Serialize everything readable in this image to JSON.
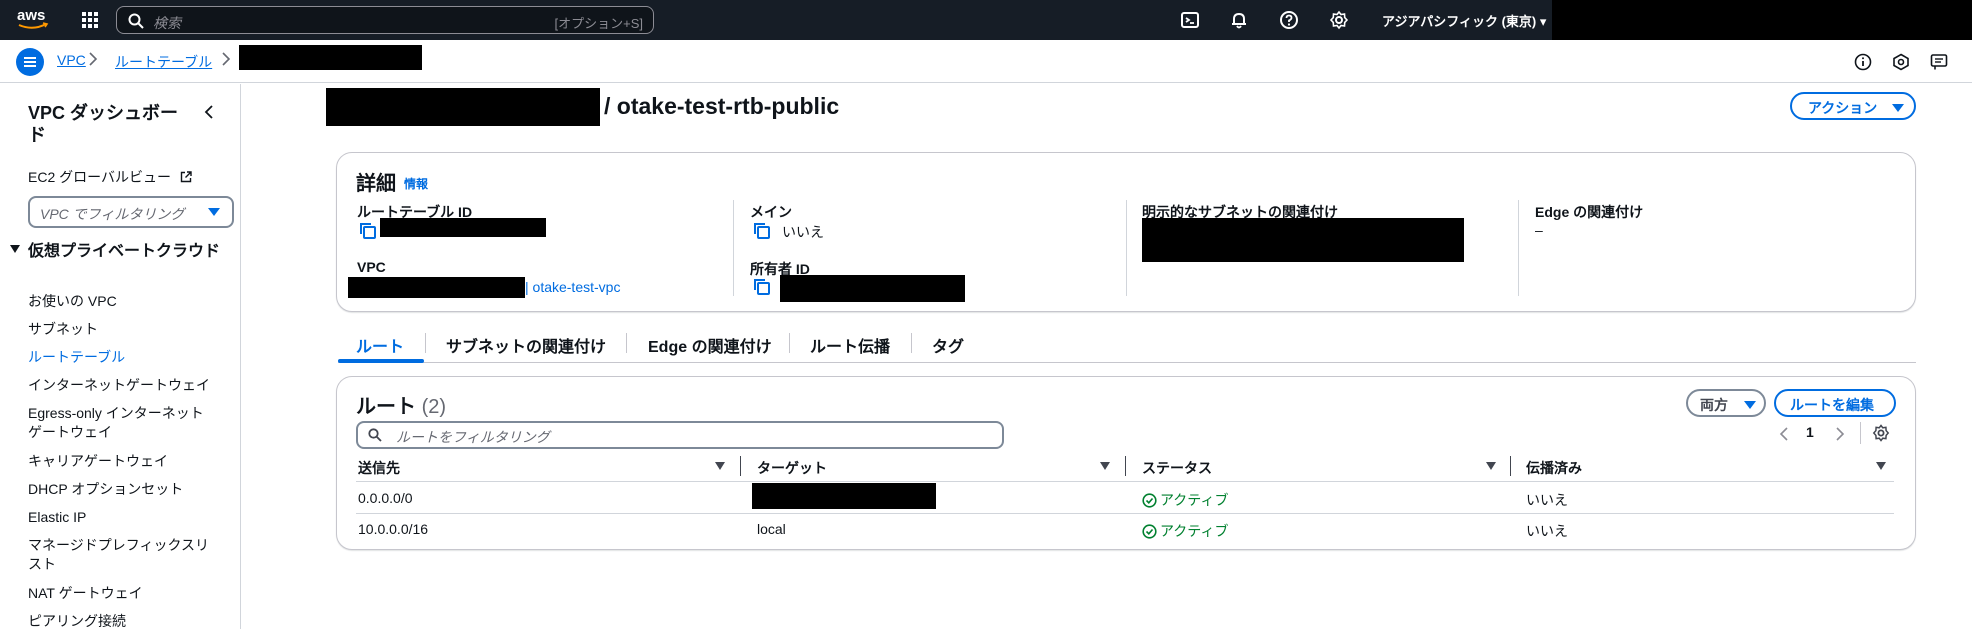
{
  "topnav": {
    "logo_text": "aws",
    "search_placeholder": "検索",
    "search_shortcut": "[オプション+S]",
    "region": "アジアパシフィック (東京) ▾"
  },
  "breadcrumb": {
    "items": [
      "VPC",
      "ルートテーブル"
    ]
  },
  "sidebar": {
    "title": "VPC ダッシュボード",
    "ec2_global_view": "EC2 グローバルビュー",
    "filter_placeholder": "VPC でフィルタリング",
    "section": "仮想プライベートクラウド",
    "items": [
      "お使いの VPC",
      "サブネット",
      "ルートテーブル",
      "インターネットゲートウェイ",
      "Egress-only インターネットゲートウェイ",
      "キャリアゲートウェイ",
      "DHCP オプションセット",
      "Elastic IP",
      "マネージドプレフィックスリスト",
      "NAT ゲートウェイ",
      "ピアリング接続"
    ]
  },
  "page": {
    "title_suffix": "/ otake-test-rtb-public",
    "actions_label": "アクション"
  },
  "details": {
    "heading": "詳細",
    "info": "情報",
    "route_table_id_label": "ルートテーブル ID",
    "main_label": "メイン",
    "main_value": "いいえ",
    "explicit_subnet_label": "明示的なサブネットの関連付け",
    "edge_label": "Edge の関連付け",
    "edge_value": "–",
    "vpc_label": "VPC",
    "vpc_value": "| otake-test-vpc",
    "owner_label": "所有者 ID"
  },
  "tabs": [
    "ルート",
    "サブネットの関連付け",
    "Edge の関連付け",
    "ルート伝播",
    "タグ"
  ],
  "routes": {
    "title": "ルート",
    "count": "(2)",
    "both_label": "両方",
    "edit_label": "ルートを編集",
    "filter_placeholder": "ルートをフィルタリング",
    "page": "1",
    "columns": [
      "送信先",
      "ターゲット",
      "ステータス",
      "伝播済み"
    ],
    "rows": [
      {
        "destination": "0.0.0.0/0",
        "target": "",
        "status": "アクティブ",
        "propagated": "いいえ"
      },
      {
        "destination": "10.0.0.0/16",
        "target": "local",
        "status": "アクティブ",
        "propagated": "いいえ"
      }
    ]
  },
  "colors": {
    "accent": "#006ce0",
    "nav_bg": "#161d26",
    "success": "#00802f"
  },
  "icons": [
    "aws-logo",
    "grid-icon",
    "search-icon",
    "cloudshell-icon",
    "bell-icon",
    "help-icon",
    "gear-icon",
    "menu-icon",
    "info-icon",
    "cube-icon",
    "feedback-icon",
    "external-link-icon",
    "copy-icon",
    "check-circle-icon",
    "chevron-left-icon",
    "chevron-right-icon",
    "settings-icon",
    "sort-caret-icon"
  ]
}
